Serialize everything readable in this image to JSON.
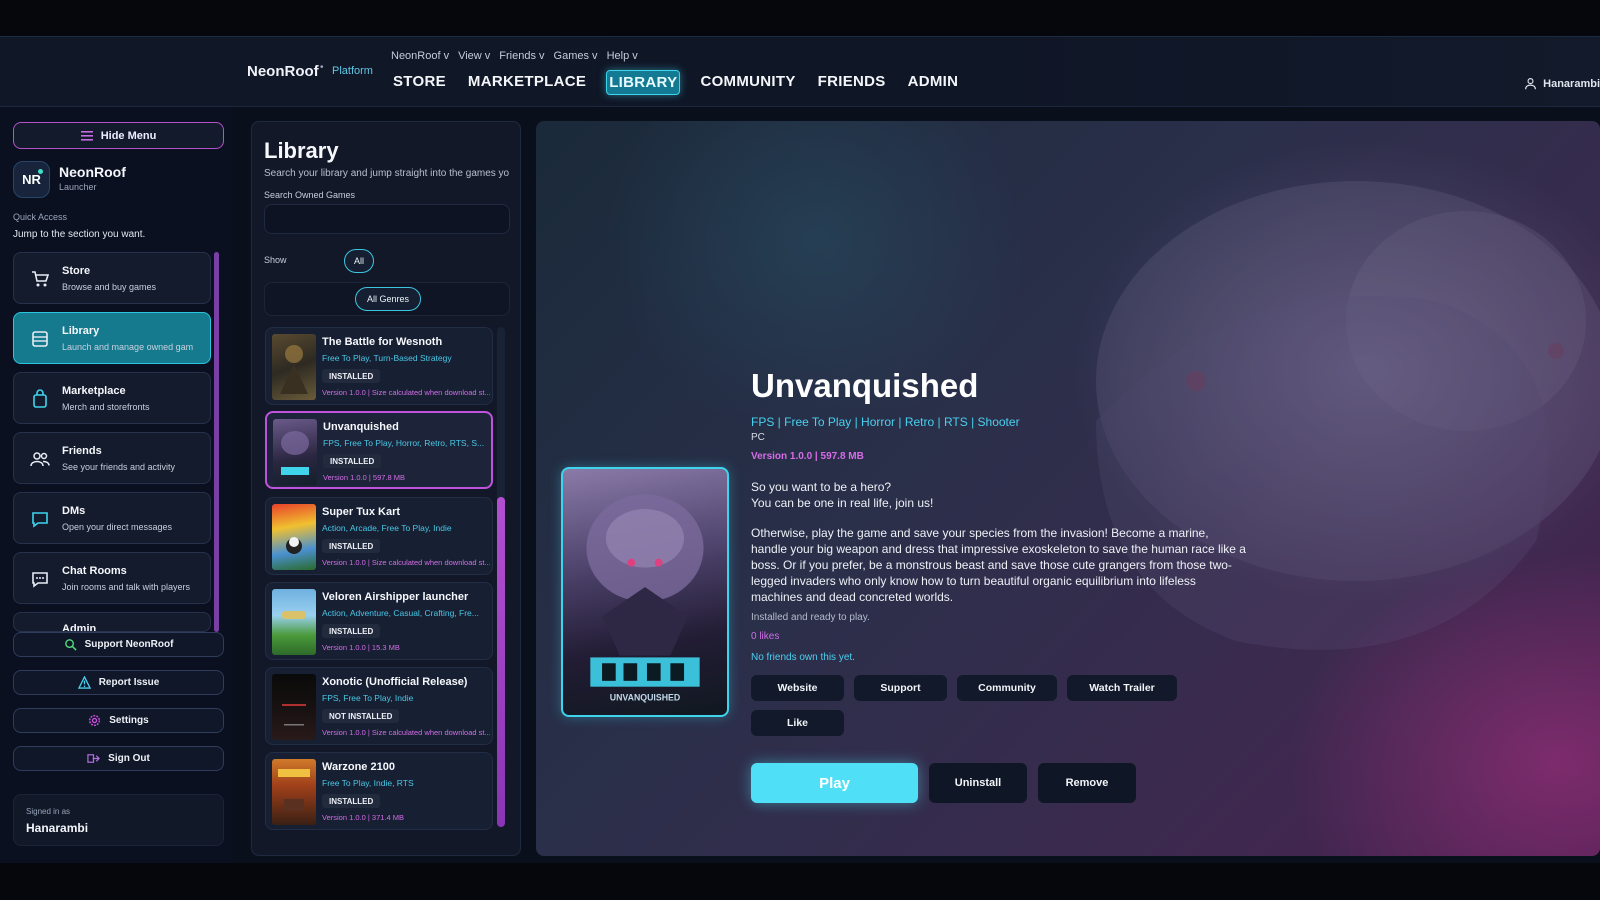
{
  "topbar": {
    "brand": "NeonRoof",
    "brand_sep": "•",
    "brand_sub": "Platform",
    "menus": [
      "NeonRoof v",
      "View v",
      "Friends v",
      "Games v",
      "Help v"
    ],
    "tabs": [
      "STORE",
      "MARKETPLACE",
      "LIBRARY",
      "COMMUNITY",
      "FRIENDS",
      "ADMIN"
    ],
    "active_tab": "LIBRARY",
    "user": "Hanarambi"
  },
  "sidebar": {
    "hide_menu": "Hide Menu",
    "logo_initials": "NR",
    "app_name": "NeonRoof",
    "app_sub": "Launcher",
    "quick_access_title": "Quick Access",
    "quick_access_sub": "Jump to the section you want.",
    "items": [
      {
        "title": "Store",
        "sub": "Browse and buy games",
        "icon": "cart-icon"
      },
      {
        "title": "Library",
        "sub": "Launch and manage owned gam",
        "icon": "library-icon"
      },
      {
        "title": "Marketplace",
        "sub": "Merch and storefronts",
        "icon": "bag-icon"
      },
      {
        "title": "Friends",
        "sub": "See your friends and activity",
        "icon": "friends-icon"
      },
      {
        "title": "DMs",
        "sub": "Open your direct messages",
        "icon": "message-icon"
      },
      {
        "title": "Chat Rooms",
        "sub": "Join rooms and talk with players",
        "icon": "chat-icon"
      },
      {
        "title": "Admin",
        "sub": "",
        "icon": "admin-icon"
      }
    ],
    "support": "Support NeonRoof",
    "report": "Report Issue",
    "settings": "Settings",
    "sign_out": "Sign Out",
    "signed_label": "Signed in as",
    "signed_user": "Hanarambi"
  },
  "library": {
    "title": "Library",
    "desc": "Search your library and jump straight into the games yo",
    "search_label": "Search Owned Games",
    "search_value": "",
    "show_label": "Show",
    "show_value": "All",
    "genre_value": "All Genres",
    "games": [
      {
        "title": "The Battle for Wesnoth",
        "genres": "Free To Play, Turn-Based Strategy",
        "status": "INSTALLED",
        "version": "Version 1.0.0 | Size calculated when download st..."
      },
      {
        "title": "Unvanquished",
        "genres": "FPS, Free To Play, Horror, Retro, RTS, S...",
        "status": "INSTALLED",
        "version": "Version 1.0.0 | 597.8 MB"
      },
      {
        "title": "Super Tux Kart",
        "genres": "Action, Arcade, Free To Play, Indie",
        "status": "INSTALLED",
        "version": "Version 1.0.0 | Size calculated when download st..."
      },
      {
        "title": "Veloren Airshipper launcher",
        "genres": "Action, Adventure, Casual, Crafting, Fre...",
        "status": "INSTALLED",
        "version": "Version 1.0.0 | 15.3 MB"
      },
      {
        "title": "Xonotic (Unofficial Release)",
        "genres": "FPS, Free To Play, Indie",
        "status": "NOT INSTALLED",
        "version": "Version 1.0.0 | Size calculated when download st..."
      },
      {
        "title": "Warzone 2100",
        "genres": "Free To Play, Indie, RTS",
        "status": "INSTALLED",
        "version": "Version 1.0.0 | 371.4 MB"
      }
    ]
  },
  "detail": {
    "title": "Unvanquished",
    "tags": "FPS | Free To Play | Horror | Retro | RTS | Shooter",
    "platform": "PC",
    "version": "Version 1.0.0 | 597.8 MB",
    "desc_line1": "So you want to be a hero?",
    "desc_line2": "You can be one in real life, join us!",
    "desc_para": "Otherwise, play the game and save your species from the invasion! Become a marine, handle your big weapon and dress that impressive exoskeleton to save the human race like a boss. Or if you prefer, be a monstrous beast and save those cute grangers from those two-legged invaders who only know how to turn beautiful organic equilibrium into lifeless machines and dead concreted worlds.",
    "status": "Installed and ready to play.",
    "likes": "0 likes",
    "friends": "No friends own this yet.",
    "links": [
      "Website",
      "Support",
      "Community",
      "Watch Trailer"
    ],
    "like": "Like",
    "play": "Play",
    "uninstall": "Uninstall",
    "remove": "Remove",
    "cover_text": "UNVANQUISHED"
  },
  "colors": {
    "accent_cyan": "#4fe0f7",
    "accent_purple": "#c053dd",
    "tag_blue": "#4ad0ef",
    "version_pink": "#d76ce8"
  }
}
